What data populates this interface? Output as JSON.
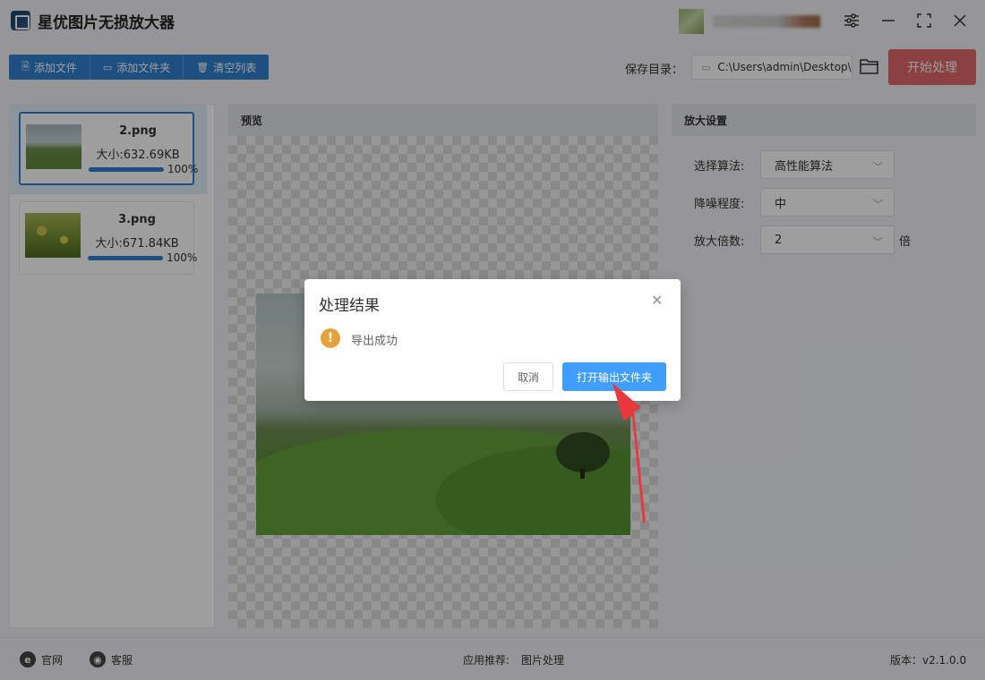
{
  "app": {
    "title": "星优图片无损放大器",
    "version_label": "版本：v2.1.0.0"
  },
  "toolbar": {
    "add_file": "添加文件",
    "add_folder": "添加文件夹",
    "clear_list": "清空列表",
    "save_dir_label": "保存目录：",
    "save_dir_value": "C:\\Users\\admin\\Desktop\\",
    "start_label": "开始处理"
  },
  "files": [
    {
      "name": "2.png",
      "size": "大小:632.69KB",
      "progress": 100,
      "progress_label": "100%",
      "selected": true
    },
    {
      "name": "3.png",
      "size": "大小:671.84KB",
      "progress": 100,
      "progress_label": "100%",
      "selected": false
    }
  ],
  "preview": {
    "header": "预览"
  },
  "settings": {
    "header": "放大设置",
    "algorithm_label": "选择算法:",
    "algorithm_value": "高性能算法",
    "denoise_label": "降噪程度:",
    "denoise_value": "中",
    "scale_label": "放大倍数:",
    "scale_value": "2",
    "scale_unit": "倍"
  },
  "statusbar": {
    "website": "官网",
    "support": "客服",
    "recommend_label": "应用推荐:",
    "recommend_value": "图片处理"
  },
  "dialog": {
    "title": "处理结果",
    "message": "导出成功",
    "cancel": "取消",
    "confirm": "打开输出文件夹"
  },
  "colors": {
    "primary": "#2f80d1",
    "start": "#e05a5a",
    "dialog_ok": "#409eff",
    "warning": "#e6a23c",
    "arrow": "#e8383d"
  }
}
